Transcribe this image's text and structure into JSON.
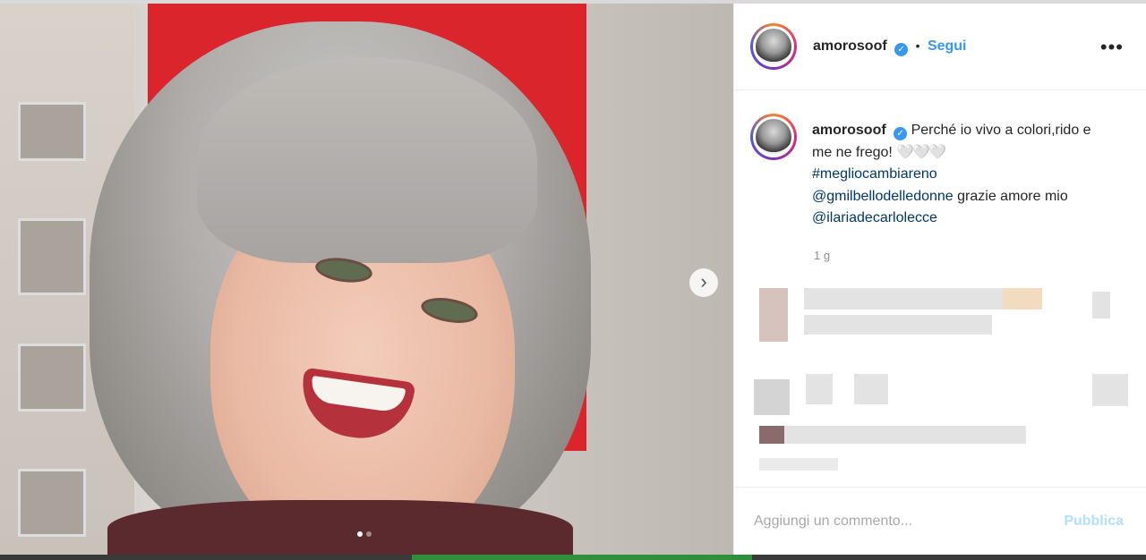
{
  "header": {
    "username": "amorosoof",
    "verified_mark": "✓",
    "separator": "•",
    "follow_label": "Segui",
    "more_label": "•••"
  },
  "post": {
    "username": "amorosoof",
    "caption_text": "Perché io vivo a colori,rido e me ne frego!",
    "hearts": "🤍🤍🤍",
    "hashtag": "#megliocambiareno",
    "mention_1": "@gmilbellodelledonne",
    "caption_text_2": "grazie amore mio",
    "mention_2": "@ilariadecarlolecce",
    "timestamp": "1 g"
  },
  "comment_box": {
    "placeholder": "Aggiungi un commento...",
    "publish_label": "Pubblica"
  },
  "carousel": {
    "next_label": "›",
    "current_index": 1,
    "count": 2
  },
  "colors": {
    "accent": "#3897f0",
    "link": "#00376b",
    "publish_disabled": "#b2dffc"
  }
}
